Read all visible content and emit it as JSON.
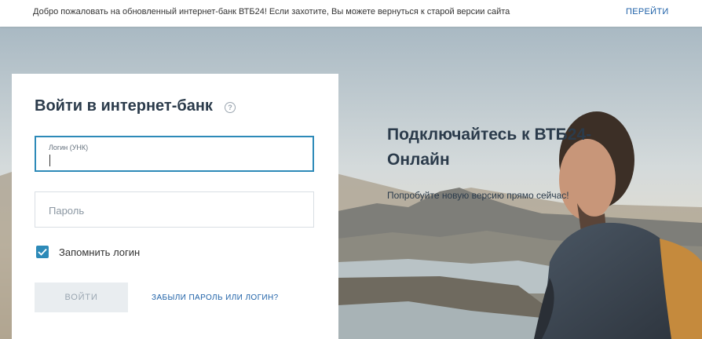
{
  "notice": {
    "text": "Добро пожаловать на обновленный интернет-банк ВТБ24! Если захотите, Вы можете вернуться к старой версии сайта",
    "link": "ПЕРЕЙТИ"
  },
  "login_card": {
    "title": "Войти в интернет-банк",
    "help_icon": "question-circle-icon",
    "help_glyph": "?",
    "login_field": {
      "label": "Логин (УНК)",
      "value": ""
    },
    "password_field": {
      "placeholder": "Пароль"
    },
    "remember": {
      "label": "Запомнить логин",
      "checked": true
    },
    "submit_label": "ВОЙТИ",
    "forgot_label": "ЗАБЫЛИ ПАРОЛЬ ИЛИ ЛОГИН?"
  },
  "promo": {
    "title": "Подключайтесь к ВТБ24-Онлайн",
    "subtitle": "Попробуйте новую версию прямо сейчас!"
  },
  "colors": {
    "accent": "#2d8ab8",
    "link": "#1f62a8",
    "heading": "#2b3b4b"
  }
}
